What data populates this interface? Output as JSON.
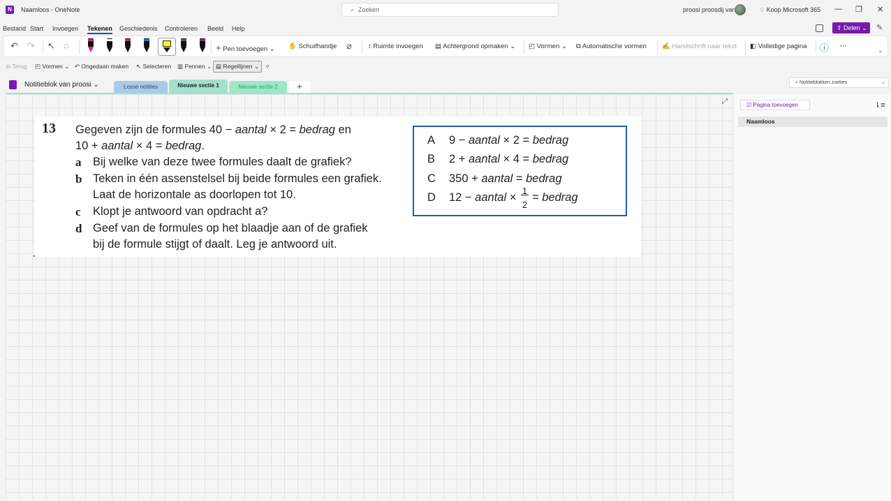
{
  "titlebar": {
    "doc_title": "Naamloos - OneNote",
    "search_placeholder": "Zoeken",
    "username": "proosi proosdij van",
    "buy": "Koop Microsoft 365",
    "minimize": "—",
    "restore": "❐",
    "close": "✕"
  },
  "menu": {
    "items": [
      "Bestand",
      "Start",
      "Invoegen",
      "Tekenen",
      "Geschiedenis",
      "Controleren",
      "Beeld",
      "Help"
    ],
    "active": "Tekenen",
    "share": "Delen"
  },
  "ribbon": {
    "pen_add": "Pen toevoegen",
    "hand": "Schuifhandje",
    "insert_space": "Ruimte invoegen",
    "background": "Achtergrond opmaken",
    "shapes": "Vormen",
    "auto_shapes": "Automatische vormen",
    "ink_to_text": "Handschrift naar tekst",
    "full_page": "Volledige pagina",
    "more": "···"
  },
  "qat": {
    "back": "Terug",
    "shapes": "Vormen",
    "undo": "Ongedaan maken",
    "select": "Selecteren",
    "pens": "Pennen",
    "rulelines": "Regellijnen"
  },
  "notebook": {
    "name": "Notitieblok van proosi",
    "tabs": [
      "Losse notities",
      "Nieuwe sectie 1",
      "Nieuwe sectie 2"
    ],
    "add_tab": "+",
    "search_placeholder": "Notitieblokken zoeken"
  },
  "sidebar": {
    "add_page": "Pagina toevoegen",
    "pages": [
      "Naamloos"
    ]
  },
  "exercise": {
    "number": "13",
    "intro_1a": "Gegeven zijn de formules 40 − ",
    "intro_1b": "aantal",
    "intro_1c": " × 2 = ",
    "intro_1d": "bedrag",
    "intro_1e": " en",
    "intro_2a": "10 + ",
    "intro_2b": "aantal",
    "intro_2c": " × 4 = ",
    "intro_2d": "bedrag",
    "intro_2e": ".",
    "a_label": "a",
    "a_text": "Bij welke van deze twee formules daalt de grafiek?",
    "b_label": "b",
    "b_text_1": "Teken in één assenstelsel bij beide formules een grafiek.",
    "b_text_2": "Laat de horizontale as doorlopen tot 10.",
    "c_label": "c",
    "c_text": "Klopt je antwoord van opdracht a?",
    "d_label": "d",
    "d_text_1": "Geef van de formules op het blaadje aan of de grafiek",
    "d_text_2": "bij de formule stijgt of daalt. Leg je antwoord uit.",
    "options": [
      {
        "letter": "A",
        "p1": "9 − ",
        "p2": "aantal",
        "p3": " × 2 = ",
        "p4": "bedrag"
      },
      {
        "letter": "B",
        "p1": "2 + ",
        "p2": "aantal",
        "p3": " × 4 = ",
        "p4": "bedrag"
      },
      {
        "letter": "C",
        "p1": "350 + ",
        "p2": "aantal",
        "p3": " = ",
        "p4": "bedrag"
      },
      {
        "letter": "D",
        "p1": "12 − ",
        "p2": "aantal",
        "p3": " × ",
        "p4": "= bedrag",
        "num": "1",
        "den": "2"
      }
    ]
  },
  "colors": {
    "accent": "#7719aa",
    "box_border": "#1f5fa8",
    "tab_active": "#a6e0cb"
  }
}
